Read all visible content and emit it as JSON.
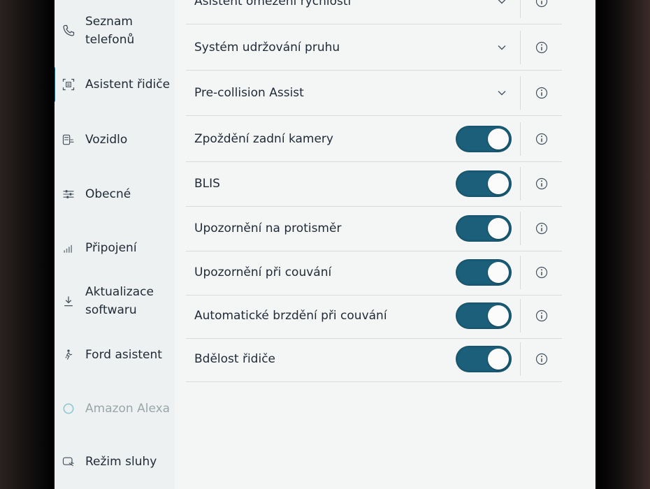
{
  "sidebar": {
    "items": [
      {
        "label": "Seznam\ntelefonů",
        "icon": "phone-icon",
        "state": "normal"
      },
      {
        "label": "Asistent řidiče",
        "icon": "driver-assist-icon",
        "state": "active"
      },
      {
        "label": "Vozidlo",
        "icon": "car-icon",
        "state": "normal"
      },
      {
        "label": "Obecné",
        "icon": "sliders-icon",
        "state": "normal"
      },
      {
        "label": "Připojení",
        "icon": "signal-bars-icon",
        "state": "normal"
      },
      {
        "label": "Aktualizace\nsoftwaru",
        "icon": "download-icon",
        "state": "normal"
      },
      {
        "label": "Ford asistent",
        "icon": "assistant-icon",
        "state": "normal"
      },
      {
        "label": "Amazon Alexa",
        "icon": "alexa-ring-icon",
        "state": "disabled"
      },
      {
        "label": "Režim sluhy",
        "icon": "valet-icon",
        "state": "normal"
      }
    ]
  },
  "settings": {
    "rows": [
      {
        "label": "Asistent omezení rychlosti",
        "control": "dropdown"
      },
      {
        "label": "Systém udržování pruhu",
        "control": "dropdown"
      },
      {
        "label": "Pre-collision Assist",
        "control": "dropdown"
      },
      {
        "label": "Zpoždění zadní kamery",
        "control": "toggle",
        "on": true
      },
      {
        "label": "BLIS",
        "control": "toggle",
        "on": true
      },
      {
        "label": "Upozornění na protisměr",
        "control": "toggle",
        "on": true
      },
      {
        "label": "Upozornění při couvání",
        "control": "toggle",
        "on": true
      },
      {
        "label": "Automatické brzdění při couvání",
        "control": "toggle",
        "on": true
      },
      {
        "label": "Bdělost řidiče",
        "control": "toggle",
        "on": true
      }
    ]
  },
  "colors": {
    "accent": "#1b5f7a",
    "text": "#1f2a36",
    "disabled_text": "#9aa6a8",
    "screen_bg": "#f4f6f6"
  }
}
